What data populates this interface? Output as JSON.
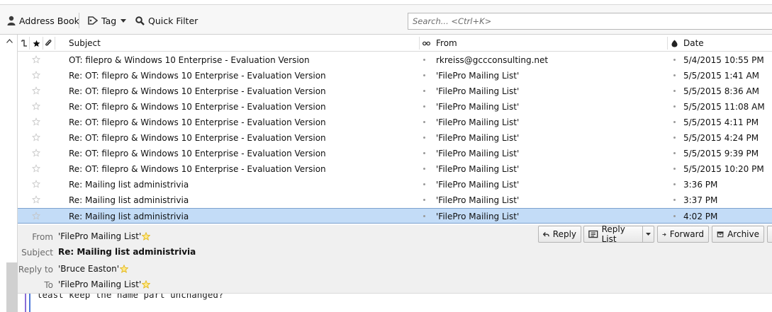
{
  "toolbar": {
    "address_book": "Address Book",
    "tag": "Tag",
    "quick_filter": "Quick Filter",
    "search_placeholder": "Search... <Ctrl+K>"
  },
  "columns": {
    "subject": "Subject",
    "from": "From",
    "date": "Date"
  },
  "messages": [
    {
      "subject": "OT: filepro & Windows 10 Enterprise - Evaluation Version",
      "from": "rkreiss@gccconsulting.net",
      "date": "5/4/2015 10:55 PM",
      "selected": false
    },
    {
      "subject": "Re: OT: filepro & Windows 10 Enterprise - Evaluation Version",
      "from": "'FilePro Mailing List'",
      "date": "5/5/2015 1:41 AM",
      "selected": false
    },
    {
      "subject": "Re: OT: filepro & Windows 10 Enterprise - Evaluation Version",
      "from": "'FilePro Mailing List'",
      "date": "5/5/2015 8:36 AM",
      "selected": false
    },
    {
      "subject": "Re: OT: filepro & Windows 10 Enterprise - Evaluation Version",
      "from": "'FilePro Mailing List'",
      "date": "5/5/2015 11:08 AM",
      "selected": false
    },
    {
      "subject": "Re: OT: filepro & Windows 10 Enterprise - Evaluation Version",
      "from": "'FilePro Mailing List'",
      "date": "5/5/2015 4:11 PM",
      "selected": false
    },
    {
      "subject": "Re: OT: filepro & Windows 10 Enterprise - Evaluation Version",
      "from": "'FilePro Mailing List'",
      "date": "5/5/2015 4:24 PM",
      "selected": false
    },
    {
      "subject": "Re: OT: filepro & Windows 10 Enterprise - Evaluation Version",
      "from": "'FilePro Mailing List'",
      "date": "5/5/2015 9:39 PM",
      "selected": false
    },
    {
      "subject": "Re: OT: filepro & Windows 10 Enterprise - Evaluation Version",
      "from": "'FilePro Mailing List'",
      "date": "5/5/2015 10:20 PM",
      "selected": false
    },
    {
      "subject": "Re: Mailing list administrivia",
      "from": "'FilePro Mailing List'",
      "date": "3:36 PM",
      "selected": false
    },
    {
      "subject": "Re: Mailing list administrivia",
      "from": "'FilePro Mailing List'",
      "date": "3:37 PM",
      "selected": false
    },
    {
      "subject": "Re: Mailing list administrivia",
      "from": "'FilePro Mailing List'",
      "date": "4:02 PM",
      "selected": true
    }
  ],
  "header_pane": {
    "from_label": "From",
    "from_value": "'FilePro Mailing List'",
    "subject_label": "Subject",
    "subject_value": "Re: Mailing list administrivia",
    "reply_to_label": "Reply to",
    "reply_to_value": "'Bruce Easton'",
    "to_label": "To",
    "to_value": "'FilePro Mailing List'"
  },
  "actions": {
    "reply": "Reply",
    "reply_list": "Reply List",
    "forward": "Forward",
    "archive": "Archive"
  },
  "body": {
    "line": "least keep the name part unchanged?"
  },
  "colors": {
    "selection": "#c3dcf7",
    "quote_outer": "#8a6ed8",
    "quote_inner": "#4f7ad8",
    "star_outline": "#c8c8c8",
    "star_gold": "#f0c419"
  }
}
